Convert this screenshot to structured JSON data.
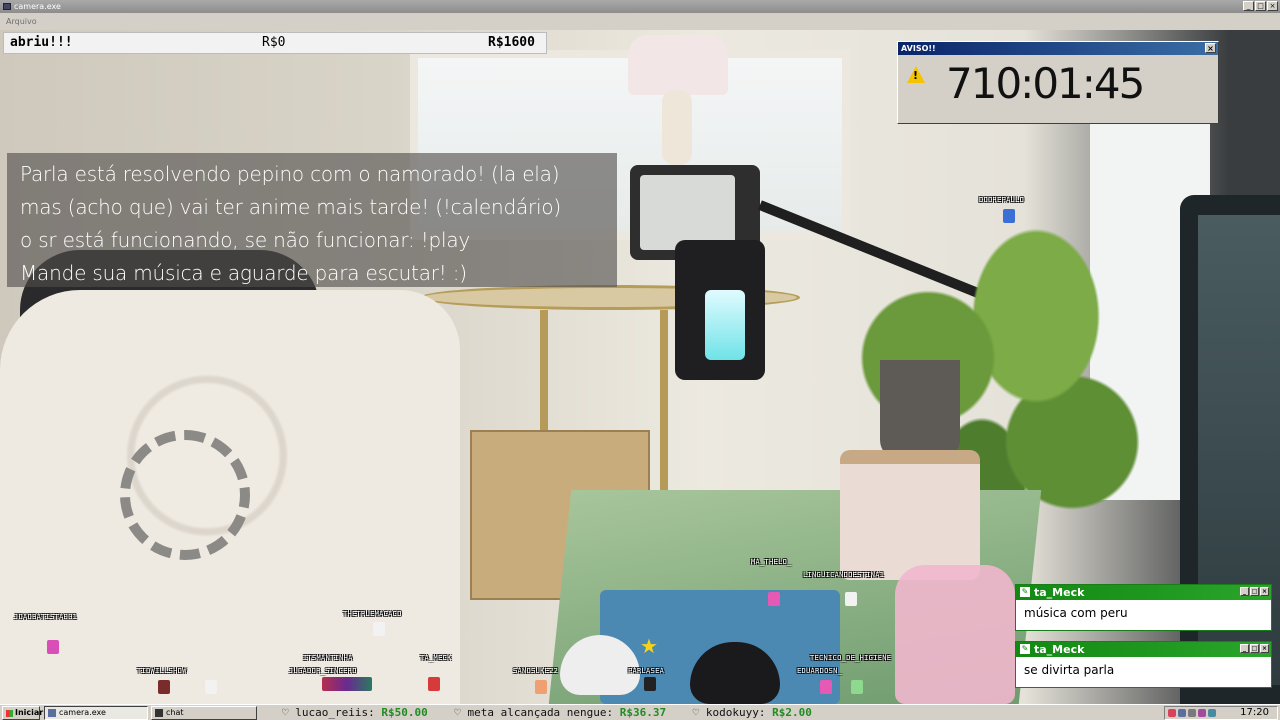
{
  "window": {
    "title": "camera.exe",
    "menu": "Arquivo",
    "controls": [
      "_",
      "□",
      "×"
    ]
  },
  "donation_bar": {
    "label": "abriu!!!",
    "current": "R$0",
    "goal": "R$1600"
  },
  "announcement": {
    "lines": [
      "Parla está resolvendo pepino com o namorado! (la ela)",
      "mas (acho que) vai ter anime mais tarde! (!calendário)",
      "o sr está funcionando, se não funcionar: !play",
      "Mande sua música e aguarde para escutar! :)"
    ]
  },
  "aviso": {
    "title": "AVISO!!",
    "close": "×",
    "timer": "710:01:45"
  },
  "chat_messages": [
    {
      "user": "ta_Meck",
      "text": "música com peru"
    },
    {
      "user": "ta_Meck",
      "text": "se divirta parla"
    }
  ],
  "stream_users": [
    {
      "name": "DOOREPAULO",
      "color": "#3b6fd6"
    },
    {
      "name": "MA_THELO_",
      "color": "#e65ab6"
    },
    {
      "name": "LINGUICANDOESTINA1",
      "color": "#ffffff"
    },
    {
      "name": "JOAOBATISTA001",
      "color": "#d94fb8"
    },
    {
      "name": "THETRUEMACACO",
      "color": "#ffffff"
    },
    {
      "name": "TIOWILLSHOW",
      "color": "#7a2b2b"
    },
    {
      "name": "ITSMANTINHA",
      "color": "#ffffff"
    },
    {
      "name": "JUGADOR_SINCERO",
      "color": "#b52f4f"
    },
    {
      "name": "TA_MECK",
      "color": "#d63a3a"
    },
    {
      "name": "SANOSUKE22",
      "color": "#f0a070"
    },
    {
      "name": "PARLASEA",
      "color": "#222222"
    },
    {
      "name": "TECNICO_DE_HIGIENE",
      "color": "#ffffff"
    },
    {
      "name": "EDUARDOSN_",
      "color": "#e65ab6"
    }
  ],
  "taskbar": {
    "start_label": "Iniciar",
    "tasks": [
      {
        "label": "camera.exe",
        "active": true
      },
      {
        "label": "chat",
        "active": false
      }
    ],
    "ticker": [
      {
        "user": "lucao_reiis:",
        "amount": "R$50.00"
      },
      {
        "user": "meta alcançada nengue:",
        "amount": "R$36.37"
      },
      {
        "user": "kodokuyy:",
        "amount": "R$2.00"
      }
    ],
    "clock": "17:20"
  },
  "colors": {
    "chat_header": "#138913",
    "aviso_header": "#0a246a",
    "donation_amount": "#228b22"
  }
}
